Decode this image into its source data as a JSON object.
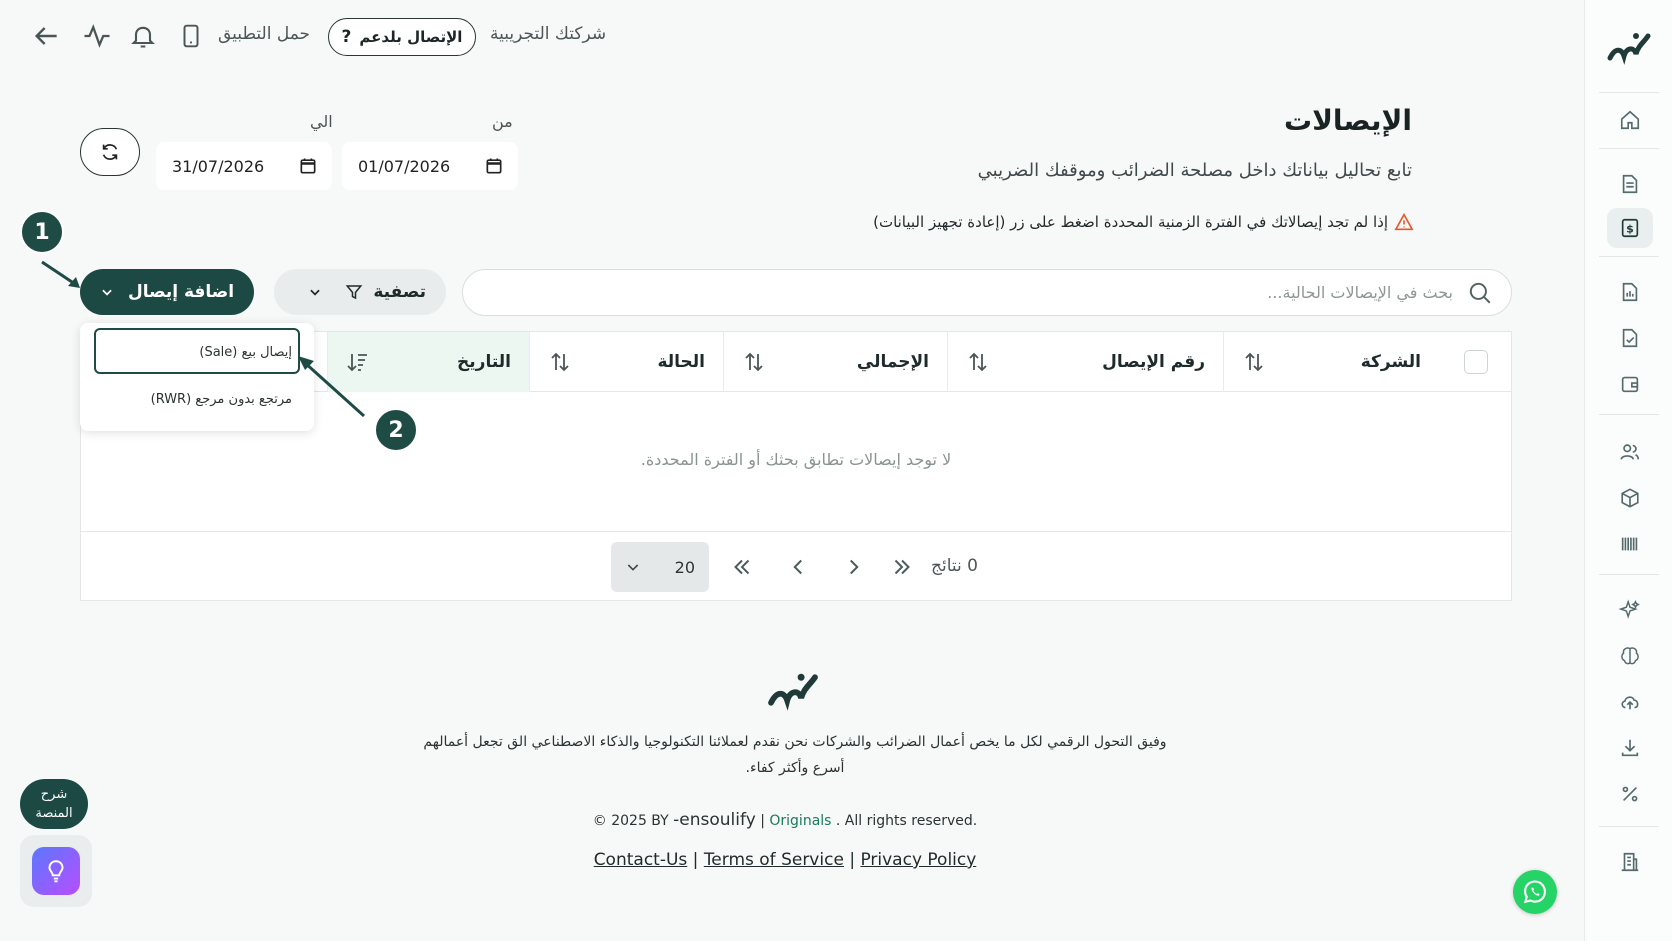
{
  "topbar": {
    "company": "شركتك التجريبية",
    "support_label": "الإتصال بلدعم",
    "app_download": "حمل التطبيق"
  },
  "page": {
    "title": "الإيصالات",
    "subtitle": "تابع تحاليل بياناتك داخل مصلحة الضرائب وموقفك الضريبي",
    "warning": "إذا لم تجد إيصالاتك في الفترة الزمنية المحددة اضغط على زر (إعادة تجهيز البيانات)"
  },
  "dates": {
    "from_label": "من",
    "from_value": "01/07/2026",
    "to_label": "الي",
    "to_value": "31/07/2026"
  },
  "annotations": {
    "step1": "1",
    "step2": "2"
  },
  "toolbar": {
    "add_label": "اضافة إيصال",
    "filter_label": "تصفية",
    "search_placeholder": "بحث في الإيصالات الحالية..."
  },
  "add_menu": {
    "items": [
      "إيصال بيع (Sale)",
      "مرتجع بدون مرجع (RWR)"
    ]
  },
  "table": {
    "columns": [
      "الشركة",
      "رقم الإيصال",
      "الإجمالي",
      "الحالة",
      "التاريخ"
    ],
    "empty_text": "لا توجد إيصالات تطابق بحثك أو الفترة المحددة."
  },
  "pagination": {
    "page_size": "20",
    "results": "0 نتائج"
  },
  "footer": {
    "description_line1": "وفيق التحول الرقمي لكل ما يخص أعمال الضرائب والشركات نحن نقدم لعملائنا التكنولوجيا والذكاء الاصطناعي الق تجعل أعمالهم",
    "description_line2": "أسرع وأكثر كفاء.",
    "copyright_prefix": "© 2025 BY",
    "brand": "-ensoulify",
    "originals": "Originals",
    "rights": ". All rights reserved.",
    "links": [
      "Contact-Us",
      "Terms of Service",
      "Privacy Policy"
    ]
  },
  "help": {
    "label_line1": "شرح",
    "label_line2": "المنصة"
  },
  "colors": {
    "primary": "#1c4943",
    "active_column": "#ecf7f2",
    "warning": "#e8562a",
    "whatsapp": "#25d366"
  }
}
